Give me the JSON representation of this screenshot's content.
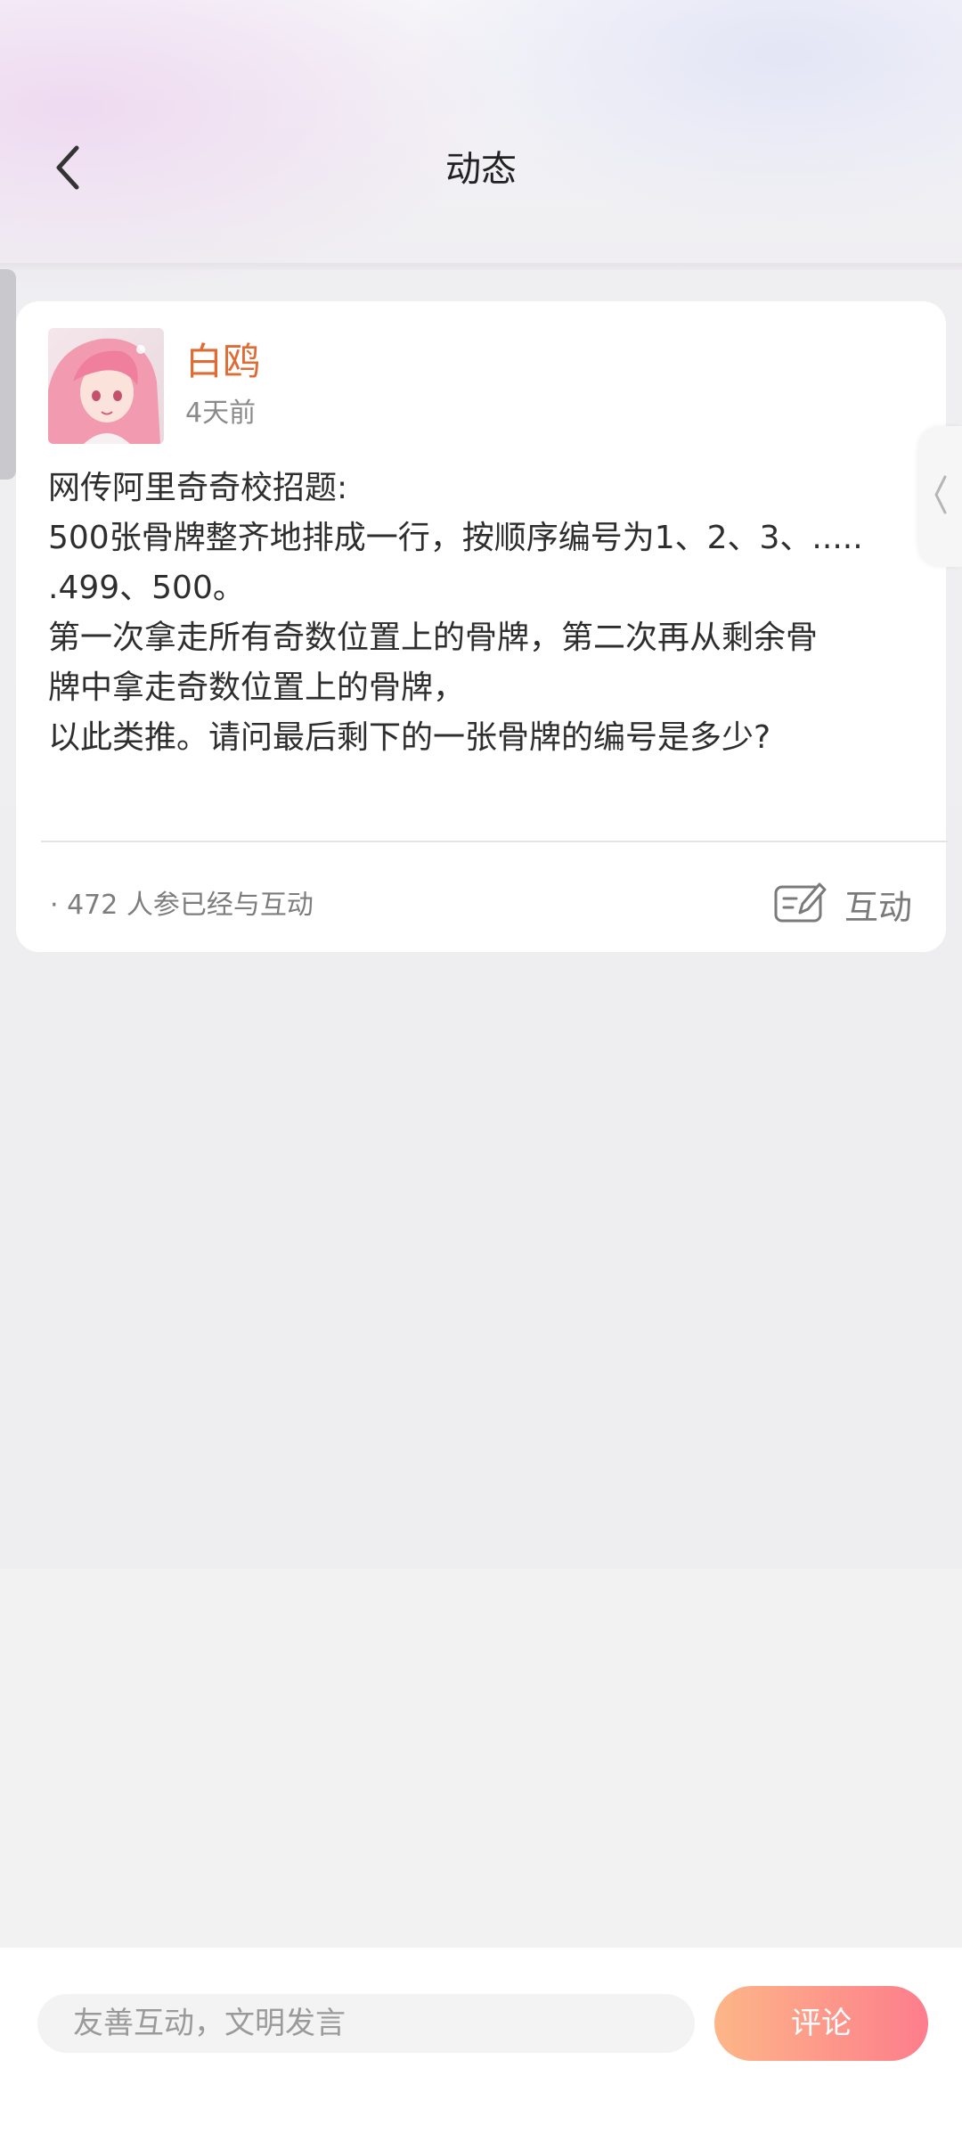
{
  "header": {
    "title": "动态",
    "back_icon": "chevron-left-icon"
  },
  "side_tab": {
    "icon": "chevron-left-icon"
  },
  "post": {
    "author": "白鸥",
    "time": "4天前",
    "lines": [
      "网传阿里奇奇校招题:",
      "500张骨牌整齐地排成一行，按顺序编号为1、2、3、.....",
      ".499、500。",
      "第一次拿走所有奇数位置上的骨牌，第二次再从剩余骨",
      "牌中拿走奇数位置上的骨牌，",
      "以此类推。请问最后剩下的一张骨牌的编号是多少?"
    ],
    "participants_text": "· 472  人参已经与互动",
    "interact_label": "互动",
    "interact_icon": "edit-note-icon"
  },
  "bottom_bar": {
    "input_placeholder": "友善互动，文明发言",
    "input_value": "",
    "comment_label": "评论"
  },
  "colors": {
    "author_name": "#e06c35",
    "comment_gradient_start": "#fdb688",
    "comment_gradient_end": "#fd7d8c"
  }
}
